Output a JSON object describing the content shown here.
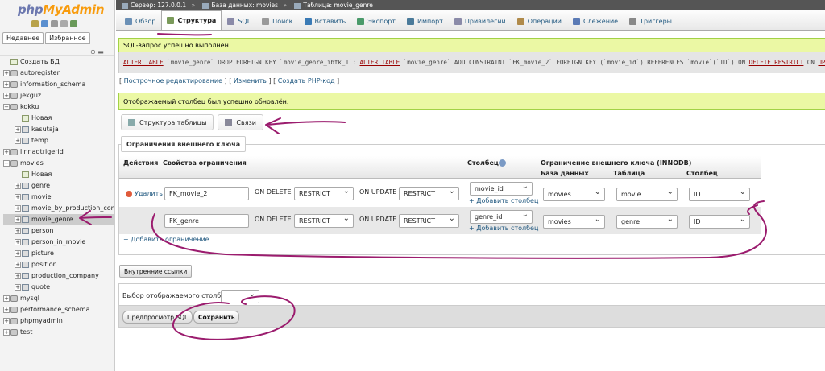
{
  "nav": {
    "logo_php": "php",
    "logo_myadmin": "MyAdmin",
    "tab_recent": "Недавнее",
    "tab_favorites": "Избранное",
    "tree": [
      {
        "label": "Создать БД",
        "level": 1,
        "kind": "new"
      },
      {
        "label": "autoregister",
        "level": 1,
        "kind": "db"
      },
      {
        "label": "information_schema",
        "level": 1,
        "kind": "db"
      },
      {
        "label": "jekguz",
        "level": 1,
        "kind": "db"
      },
      {
        "label": "kokku",
        "level": 1,
        "kind": "db"
      },
      {
        "label": "Новая",
        "level": 2,
        "kind": "new"
      },
      {
        "label": "kasutaja",
        "level": 2,
        "kind": "table"
      },
      {
        "label": "temp",
        "level": 2,
        "kind": "table"
      },
      {
        "label": "linnadtrigerid",
        "level": 1,
        "kind": "db"
      },
      {
        "label": "movies",
        "level": 1,
        "kind": "db"
      },
      {
        "label": "Новая",
        "level": 2,
        "kind": "new"
      },
      {
        "label": "genre",
        "level": 2,
        "kind": "table"
      },
      {
        "label": "movie",
        "level": 2,
        "kind": "table"
      },
      {
        "label": "movie_by_production_compa",
        "level": 2,
        "kind": "table"
      },
      {
        "label": "movie_genre",
        "level": 2,
        "kind": "table"
      },
      {
        "label": "person",
        "level": 2,
        "kind": "table"
      },
      {
        "label": "person_in_movie",
        "level": 2,
        "kind": "table"
      },
      {
        "label": "picture",
        "level": 2,
        "kind": "table"
      },
      {
        "label": "position",
        "level": 2,
        "kind": "table"
      },
      {
        "label": "production_company",
        "level": 2,
        "kind": "table"
      },
      {
        "label": "quote",
        "level": 2,
        "kind": "table"
      },
      {
        "label": "mysql",
        "level": 1,
        "kind": "db"
      },
      {
        "label": "performance_schema",
        "level": 1,
        "kind": "db"
      },
      {
        "label": "phpmyadmin",
        "level": 1,
        "kind": "db"
      },
      {
        "label": "test",
        "level": 1,
        "kind": "db"
      }
    ]
  },
  "breadcrumb": {
    "server": "Сервер: 127.0.0.1",
    "database": "База данных: movies",
    "table": "Таблица: movie_genre",
    "separator": "»"
  },
  "menu": {
    "tabs": [
      {
        "label": "Обзор",
        "icon": "browse-icon",
        "color": "#6a8fb5"
      },
      {
        "label": "Структура",
        "icon": "structure-icon",
        "color": "#7a9a5a"
      },
      {
        "label": "SQL",
        "icon": "sql-icon",
        "color": "#8a8aa8"
      },
      {
        "label": "Поиск",
        "icon": "search-icon",
        "color": "#999999"
      },
      {
        "label": "Вставить",
        "icon": "insert-icon",
        "color": "#3a7ab5"
      },
      {
        "label": "Экспорт",
        "icon": "export-icon",
        "color": "#4a9a6a"
      },
      {
        "label": "Импорт",
        "icon": "import-icon",
        "color": "#4a7a9a"
      },
      {
        "label": "Привилегии",
        "icon": "privileges-icon",
        "color": "#8a8aa8"
      },
      {
        "label": "Операции",
        "icon": "operations-icon",
        "color": "#b08a4a"
      },
      {
        "label": "Слежение",
        "icon": "tracking-icon",
        "color": "#5a7ab5"
      },
      {
        "label": "Триггеры",
        "icon": "triggers-icon",
        "color": "#888888"
      }
    ]
  },
  "messages": {
    "sql_success": "SQL-запрос успешно выполнен.",
    "display_success": "Отображаемый столбец был успешно обновлён."
  },
  "sql": {
    "kw1": "ALTER TABLE",
    "p1": " `movie_genre` DROP FOREIGN KEY `movie_genre_ibfk_1`; ",
    "kw2": "ALTER TABLE",
    "p2": " `movie_genre` ADD CONSTRAINT `FK_movie_2` FOREIGN KEY (`movie_id`) REFERENCES `movie`(`ID`) ON ",
    "kw3": "DELETE RESTRICT",
    "p3": " ON ",
    "kw4": "UPDATE RES"
  },
  "sql_links": {
    "inline_edit": "Построчное редактирование",
    "edit": "Изменить",
    "create_php": "Создать PHP-код"
  },
  "subtabs": {
    "structure": "Структура таблицы",
    "relations": "Связи"
  },
  "fk": {
    "legend": "Ограничения внешнего ключа",
    "col_actions": "Действия",
    "col_props": "Свойства ограничения",
    "col_column": "Столбец",
    "col_fk": "Ограничение внешнего ключа (INNODB)",
    "col_db": "База данных",
    "col_table": "Таблица",
    "col_refcol": "Столбец",
    "delete_label": "Удалить",
    "on_delete": "ON DELETE",
    "on_update": "ON UPDATE",
    "add_column": "+ Добавить столбец",
    "add_constraint": "+ Добавить ограничение",
    "rows": [
      {
        "name": "FK_movie_2",
        "on_delete": "RESTRICT",
        "on_update": "RESTRICT",
        "column": "movie_id",
        "db": "movies",
        "table": "movie",
        "refcol": "ID"
      },
      {
        "name": "FK_genre",
        "on_delete": "RESTRICT",
        "on_update": "RESTRICT",
        "column": "genre_id",
        "db": "movies",
        "table": "genre",
        "refcol": "ID"
      }
    ]
  },
  "internal": {
    "button": "Внутренние ссылки",
    "display_label": "Выбор отображаемого столбца",
    "display_value": ""
  },
  "footer": {
    "preview": "Предпросмотр SQL",
    "save": "Сохранить"
  },
  "colors": {
    "success_bg": "#ebf8a4",
    "link": "#235a81",
    "annotation": "#9b1c6e"
  }
}
